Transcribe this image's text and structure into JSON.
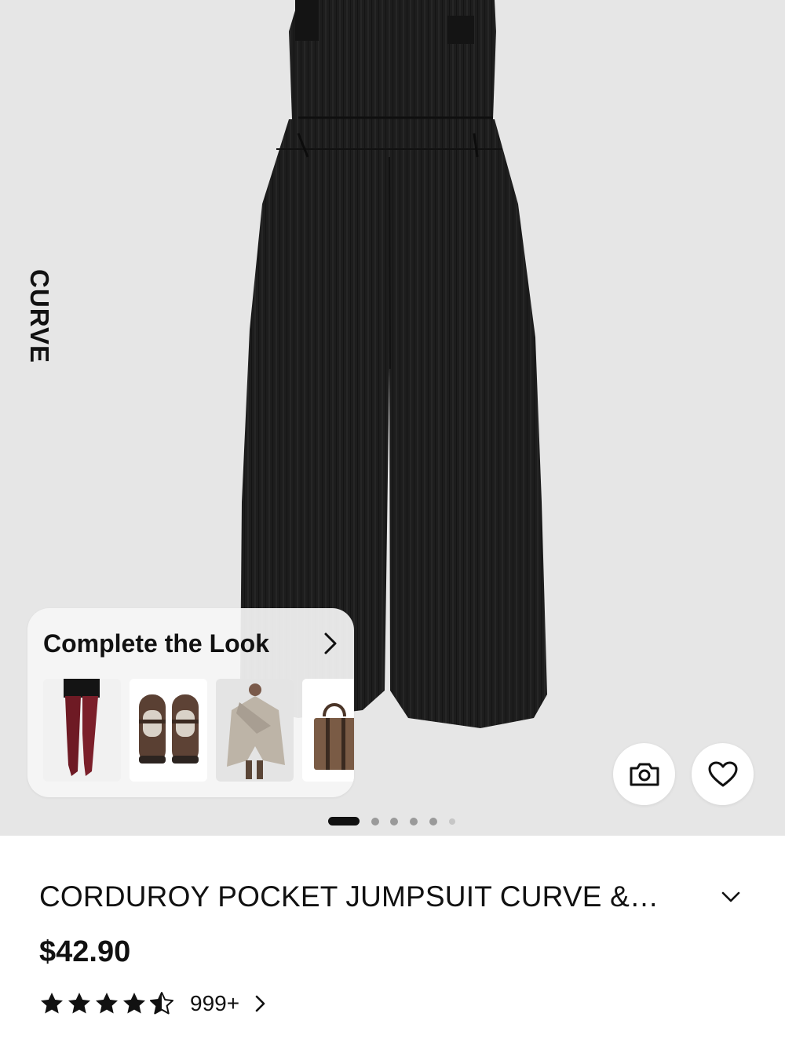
{
  "gallery": {
    "brand_label": "CURVE",
    "slide_count": 6,
    "active_slide": 1
  },
  "complete_the_look": {
    "title": "Complete the Look",
    "items": [
      {
        "name": "burgundy-tights"
      },
      {
        "name": "brown-mary-jane-shoes"
      },
      {
        "name": "grey-wrap-cape"
      },
      {
        "name": "brown-tote-bag"
      }
    ]
  },
  "actions": {
    "camera_icon": "camera-icon",
    "wishlist_icon": "heart-icon"
  },
  "product": {
    "title": "CORDUROY POCKET JUMPSUIT CURVE &…",
    "price": "$42.90",
    "rating": 4.5,
    "review_count": "999+"
  },
  "colors": {
    "gallery_bg": "#e6e6e6",
    "text": "#111111",
    "garment": "#1c1c1c"
  }
}
